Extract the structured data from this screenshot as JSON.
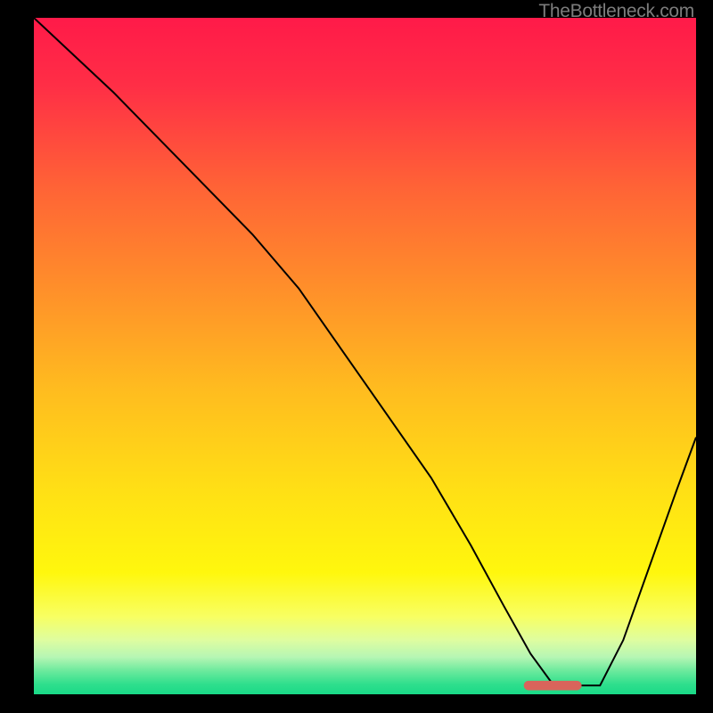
{
  "watermark": "TheBottleneck.com",
  "chart_data": {
    "type": "line",
    "title": "",
    "xlabel": "",
    "ylabel": "",
    "xlim": [
      0,
      100
    ],
    "ylim": [
      0,
      100
    ],
    "grid": false,
    "background_gradient": {
      "stops": [
        {
          "offset": 0.0,
          "color": "#ff1a49"
        },
        {
          "offset": 0.1,
          "color": "#ff2e46"
        },
        {
          "offset": 0.25,
          "color": "#ff6336"
        },
        {
          "offset": 0.4,
          "color": "#ff8f2a"
        },
        {
          "offset": 0.55,
          "color": "#ffbc1f"
        },
        {
          "offset": 0.7,
          "color": "#ffe015"
        },
        {
          "offset": 0.82,
          "color": "#fff70d"
        },
        {
          "offset": 0.885,
          "color": "#f8ff62"
        },
        {
          "offset": 0.92,
          "color": "#defda0"
        },
        {
          "offset": 0.945,
          "color": "#b6f6b4"
        },
        {
          "offset": 0.965,
          "color": "#6dea9d"
        },
        {
          "offset": 0.985,
          "color": "#2fdf8d"
        },
        {
          "offset": 1.0,
          "color": "#19d987"
        }
      ]
    },
    "series": [
      {
        "name": "bottleneck-curve",
        "color": "#000000",
        "x": [
          0,
          12,
          23,
          33,
          40,
          50,
          60,
          66,
          71,
          75,
          78.5,
          81,
          85.5,
          89,
          93,
          97,
          100
        ],
        "values": [
          100,
          89,
          78,
          68,
          60,
          46,
          32,
          22,
          13,
          6,
          1.3,
          1.3,
          1.3,
          8,
          19,
          30,
          38
        ]
      }
    ],
    "marker": {
      "name": "optimal-range-marker",
      "color": "#d9645b",
      "x_start": 74.7,
      "x_end": 82.0,
      "y": 1.3,
      "thickness": 1.4
    }
  }
}
